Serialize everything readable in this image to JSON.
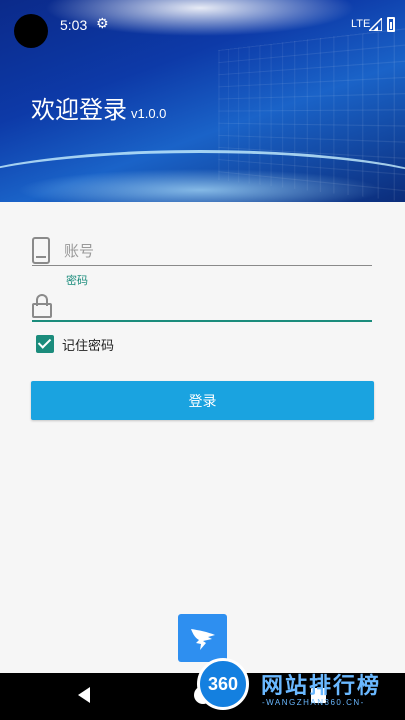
{
  "status_bar": {
    "time": "5:03",
    "network": "LTE",
    "icons": [
      "gear-icon",
      "signal-icon",
      "battery-icon"
    ]
  },
  "header": {
    "title": "欢迎登录",
    "version": "v1.0.0"
  },
  "form": {
    "account_placeholder": "账号",
    "account_value": "",
    "password_label": "密码",
    "password_value": "",
    "remember_label": "记住密码",
    "remember_checked": true,
    "login_button": "登录"
  },
  "colors": {
    "accent": "#1b8c7c",
    "button": "#1aa3e0",
    "badge": "#2e8ff0"
  },
  "watermark": {
    "badge_text": "360",
    "text": "网站排行榜",
    "sub": "-WANGZHAN360.CN-"
  }
}
